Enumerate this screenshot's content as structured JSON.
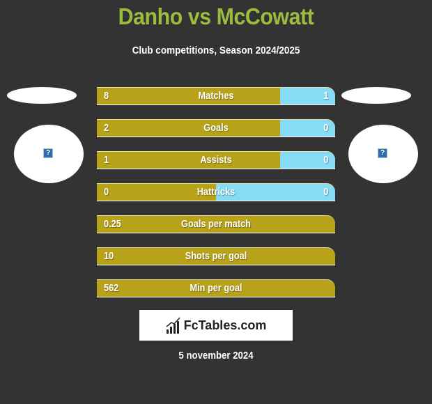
{
  "header": {
    "title": "Danho vs McCowatt",
    "subtitle": "Club competitions, Season 2024/2025"
  },
  "players": {
    "left": {
      "name": "Danho",
      "logo_icon": "image-placeholder-icon",
      "logo_glyph": "?"
    },
    "right": {
      "name": "McCowatt",
      "logo_icon": "image-placeholder-icon",
      "logo_glyph": "?"
    }
  },
  "colors": {
    "left_bar": "#b8a21a",
    "right_bar": "#87dcf5",
    "title": "#9dbb3e",
    "background": "#333333"
  },
  "stats": [
    {
      "label": "Matches",
      "left": "8",
      "right": "1",
      "right_share": 0.23
    },
    {
      "label": "Goals",
      "left": "2",
      "right": "0",
      "right_share": 0.23
    },
    {
      "label": "Assists",
      "left": "1",
      "right": "0",
      "right_share": 0.23
    },
    {
      "label": "Hattricks",
      "left": "0",
      "right": "0",
      "right_share": 0.5
    },
    {
      "label": "Goals per match",
      "left": "0.25",
      "right": "",
      "right_share": 0
    },
    {
      "label": "Shots per goal",
      "left": "10",
      "right": "",
      "right_share": 0
    },
    {
      "label": "Min per goal",
      "left": "562",
      "right": "",
      "right_share": 0
    }
  ],
  "brand": {
    "text": "FcTables.com",
    "icon": "bar-chart-icon"
  },
  "date": "5 november 2024"
}
